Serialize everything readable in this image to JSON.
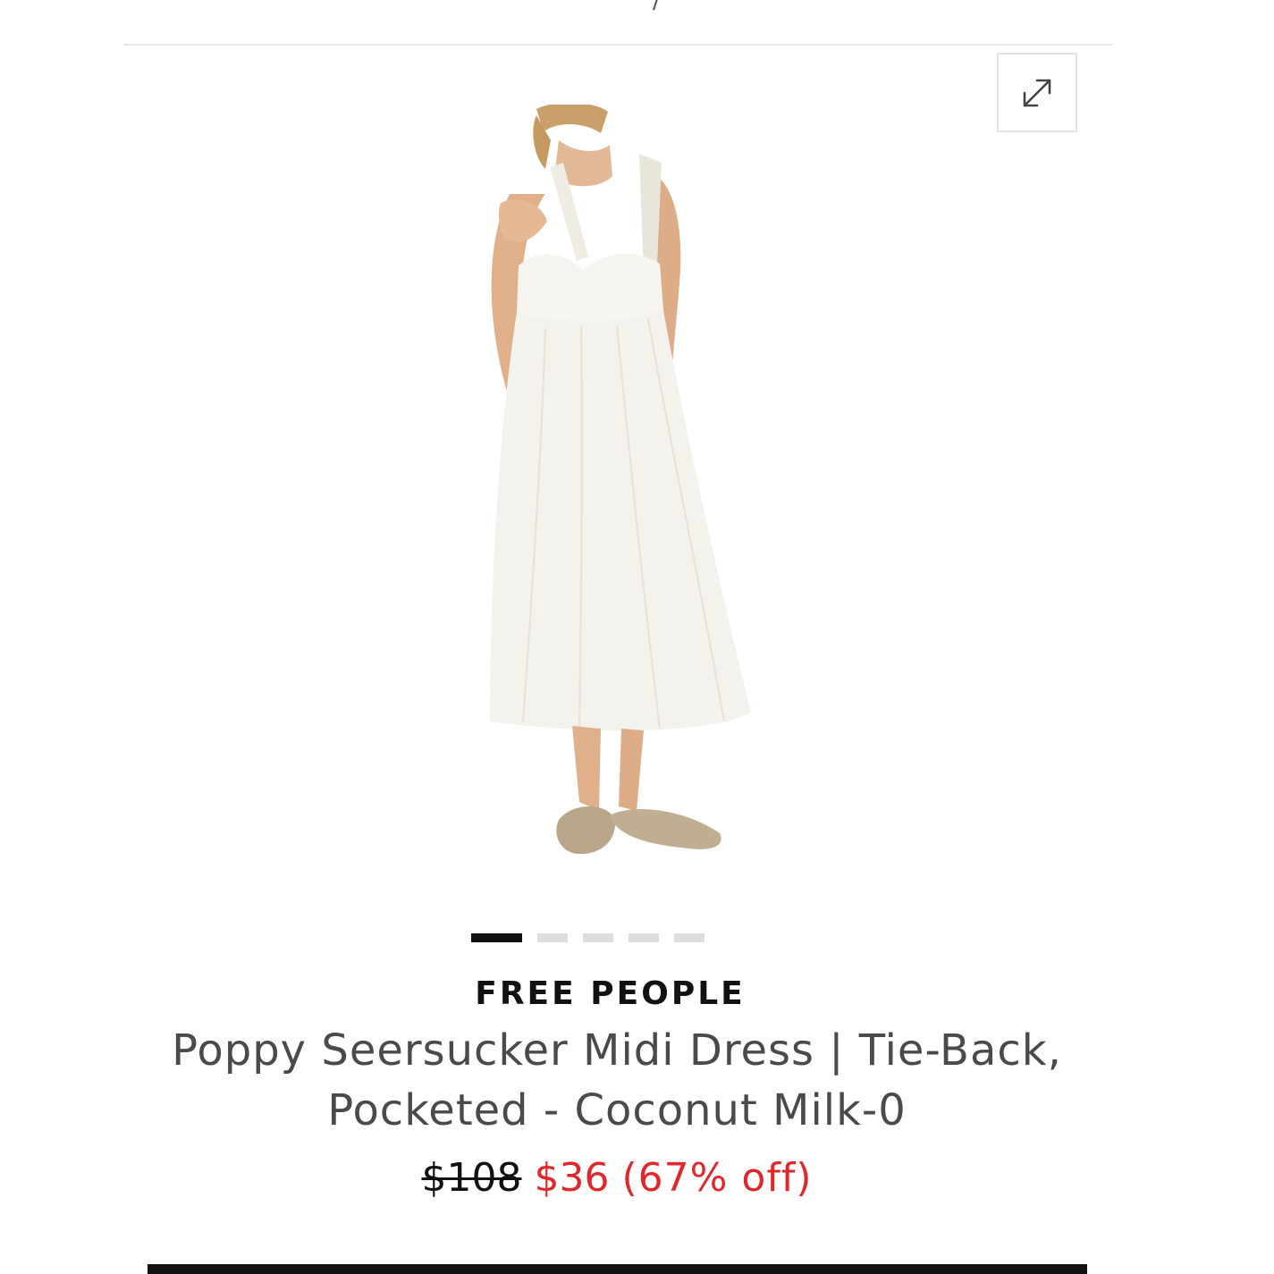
{
  "breadcrumb": {
    "separator": "/"
  },
  "gallery": {
    "expand_icon": "expand-diagonal-arrows-icon",
    "image_alt": "Free People Poppy Seersucker Midi Dress in Coconut Milk",
    "slides": 5,
    "active_slide": 1
  },
  "product": {
    "brand": "FREE PEOPLE",
    "title": "Poppy Seersucker Midi Dress | Tie-Back, Pocketed - Coconut Milk-0",
    "original_price": "$108",
    "sale_price": "$36",
    "discount": "(67% off)"
  },
  "colors": {
    "sale": "#e0282c",
    "text": "#4a4a4a",
    "brand": "#111111",
    "dress": "#f4f2ec",
    "sandal": "#b9a68a"
  }
}
